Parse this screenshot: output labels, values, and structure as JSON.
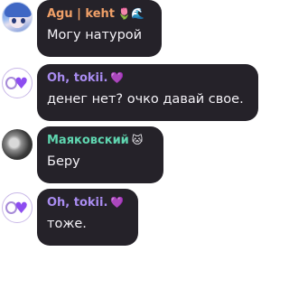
{
  "messages": [
    {
      "author": "Agu | keht",
      "author_color": "#f0a068",
      "author_emoji": "🌷🌊",
      "text": "Могу натурой",
      "avatar": "anime-avatar"
    },
    {
      "author": "Oh, tokii.",
      "author_color": "#a98cf0",
      "author_emoji": "💜",
      "text": "денег нет? очко давай свое.",
      "avatar": "purple-heart-avatar"
    },
    {
      "author": "Маяковский",
      "author_color": "#5fd6b0",
      "author_emoji": "🐱",
      "text": "Беру",
      "avatar": "photo-avatar"
    },
    {
      "author": "Oh, tokii.",
      "author_color": "#a98cf0",
      "author_emoji": "💜",
      "text": "тоже.",
      "avatar": "purple-heart-avatar"
    }
  ]
}
